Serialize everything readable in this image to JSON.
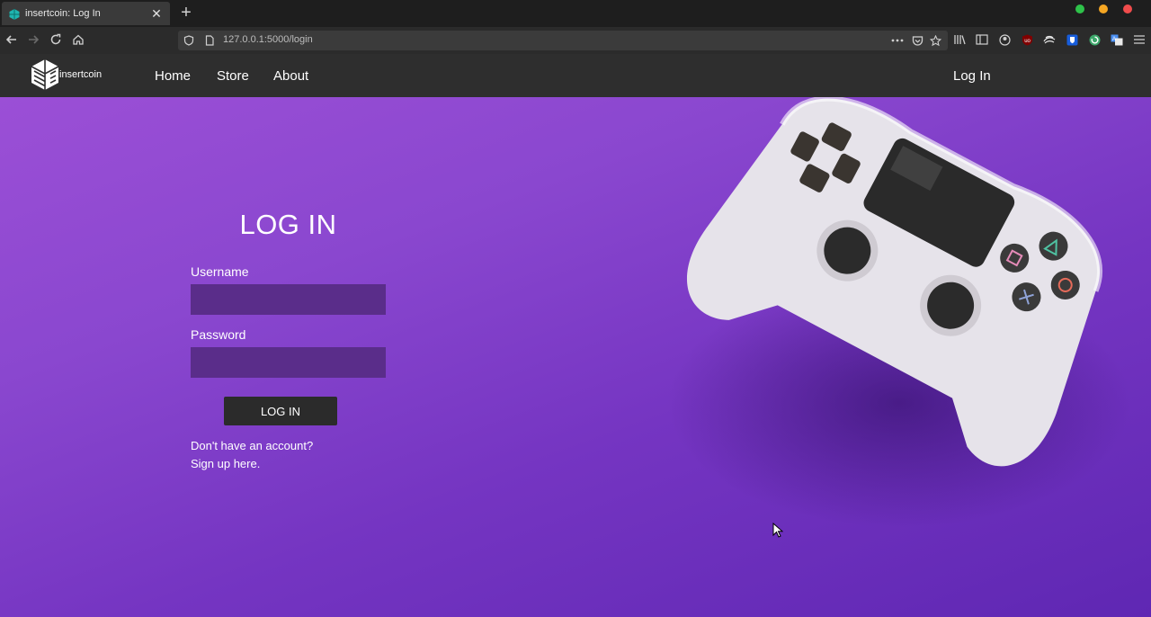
{
  "browser": {
    "tab_title": "insertcoin: Log In",
    "tab_close": "✕",
    "new_tab": "+",
    "url": "127.0.0.1:5000/login",
    "colors": {
      "traffic_green": "#2ec24a",
      "traffic_yellow": "#f5a623",
      "traffic_red": "#f14c4c"
    }
  },
  "site": {
    "logo_text": "insertcoin",
    "nav": {
      "home": "Home",
      "store": "Store",
      "about": "About",
      "login": "Log In"
    }
  },
  "login": {
    "title": "LOG IN",
    "username_label": "Username",
    "username_value": "",
    "password_label": "Password",
    "password_value": "",
    "submit_label": "LOG IN",
    "signup_prompt": "Don't have an account?",
    "signup_link": "Sign up here."
  },
  "colors": {
    "hero_top": "#9b4fd6",
    "hero_bottom": "#5f27b3",
    "navbar": "#2e2e2e",
    "input_bg": "#5a2d8a",
    "button_bg": "#2b2b2b"
  }
}
